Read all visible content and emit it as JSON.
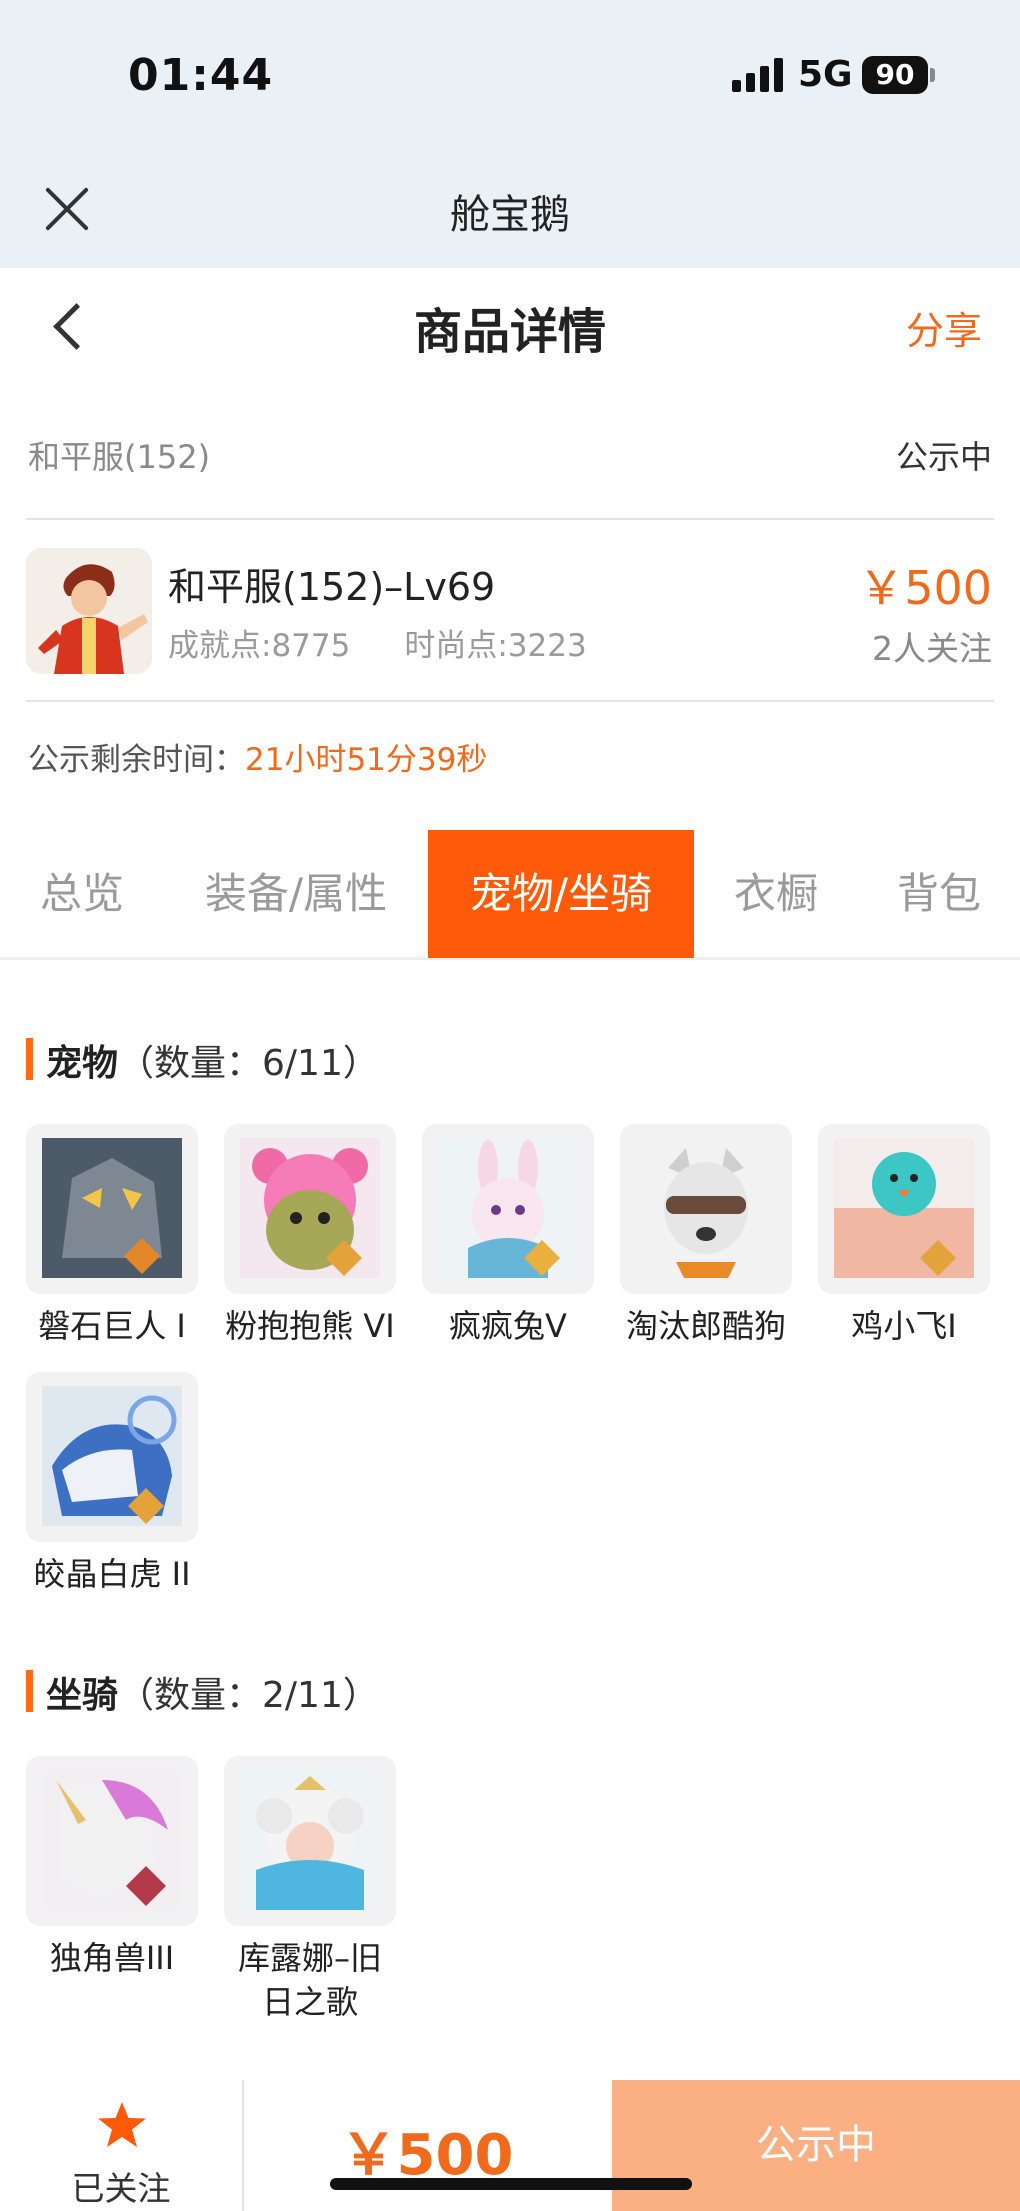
{
  "status_bar": {
    "time": "01:44",
    "network": "5G",
    "battery": "90"
  },
  "webview": {
    "app_name": "舱宝鹅"
  },
  "header": {
    "title": "商品详情",
    "share_label": "分享"
  },
  "listing": {
    "server": "和平服(152)",
    "status": "公示中",
    "name": "和平服(152)–Lv69",
    "achievement": "成就点:8775",
    "fashion": "时尚点:3223",
    "price": "￥500",
    "followers": "2人关注",
    "remaining_label": "公示剩余时间：",
    "remaining_value": "21小时51分39秒"
  },
  "tabs": [
    {
      "label": "总览",
      "active": false
    },
    {
      "label": "装备/属性",
      "active": false
    },
    {
      "label": "宠物/坐骑",
      "active": true
    },
    {
      "label": "衣橱",
      "active": false
    },
    {
      "label": "背包",
      "active": false
    }
  ],
  "pets": {
    "title": "宠物",
    "count": "（数量：6/11）",
    "items": [
      {
        "name": "磐石巨人 I",
        "icon": "stone-giant-icon"
      },
      {
        "name": "粉抱抱熊 VI",
        "icon": "pink-bear-icon"
      },
      {
        "name": "疯疯兔V",
        "icon": "crazy-rabbit-icon"
      },
      {
        "name": "淘汰郎酷狗",
        "icon": "cool-dog-icon"
      },
      {
        "name": "鸡小飞I",
        "icon": "chick-icon"
      },
      {
        "name": "皎晶白虎 II",
        "icon": "white-tiger-icon"
      }
    ]
  },
  "mounts": {
    "title": "坐骑",
    "count": "（数量：2/11）",
    "items": [
      {
        "name": "独角兽III",
        "icon": "unicorn-icon"
      },
      {
        "name": "库露娜–旧日之歌",
        "icon": "kuluna-icon"
      }
    ]
  },
  "bottom_bar": {
    "follow_label": "已关注",
    "price": "￥500",
    "action_label": "公示中"
  },
  "colors": {
    "accent": "#ff5a0a",
    "price": "#ef6a1c",
    "action_bg": "#fbb083"
  }
}
